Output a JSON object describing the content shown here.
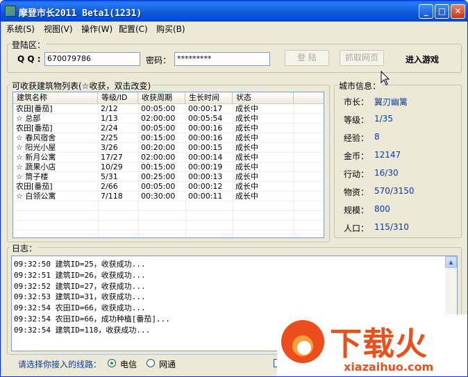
{
  "window": {
    "title": "摩登市长2011 Beta1(1231)",
    "controls": {
      "minimize": "_",
      "maximize": "□",
      "close": "✕"
    }
  },
  "menu": [
    {
      "label": "系统(S)"
    },
    {
      "label": "视图(V)"
    },
    {
      "label": "操作(W)"
    },
    {
      "label": "配置(C)"
    },
    {
      "label": "购买(B)"
    }
  ],
  "login": {
    "group_label": "登陆区：",
    "qq_label": "Q Q :",
    "qq_value": "670079786",
    "password_label": "密码：",
    "password_value": "*********",
    "login_button": "登 陆",
    "capture_button": "抓取网页",
    "enter_game": "进入游戏"
  },
  "buildings": {
    "group_label": "可收获建筑物列表(☆收获，双击改变)",
    "columns": [
      "建筑名称",
      "等级/ID",
      "收获周期",
      "生长时间",
      "状态"
    ],
    "rows": [
      {
        "name": "农田[番茄]",
        "level": "2/12",
        "cycle": "00:05:00",
        "grow": "00:00:17",
        "status": "成长中"
      },
      {
        "name": "☆ 总部",
        "level": "1/13",
        "cycle": "02:00:00",
        "grow": "00:05:54",
        "status": "成长中"
      },
      {
        "name": "农田[番茄]",
        "level": "2/24",
        "cycle": "00:05:00",
        "grow": "00:00:16",
        "status": "成长中"
      },
      {
        "name": "☆ 春风宿舍",
        "level": "2/25",
        "cycle": "00:15:00",
        "grow": "00:00:16",
        "status": "成长中"
      },
      {
        "name": "☆ 阳光小屋",
        "level": "3/26",
        "cycle": "00:20:00",
        "grow": "00:00:15",
        "status": "成长中"
      },
      {
        "name": "☆ 新月公寓",
        "level": "17/27",
        "cycle": "02:00:00",
        "grow": "00:00:14",
        "status": "成长中"
      },
      {
        "name": "☆ 蔬果小店",
        "level": "10/29",
        "cycle": "00:15:00",
        "grow": "00:00:19",
        "status": "成长中"
      },
      {
        "name": "☆ 筒子楼",
        "level": "5/31",
        "cycle": "00:25:00",
        "grow": "00:00:13",
        "status": "成长中"
      },
      {
        "name": "农田[番茄]",
        "level": "2/66",
        "cycle": "00:05:00",
        "grow": "00:00:12",
        "status": "成长中"
      },
      {
        "name": "☆ 白领公寓",
        "level": "7/118",
        "cycle": "00:30:00",
        "grow": "00:00:11",
        "status": "成长中"
      }
    ]
  },
  "city_info": {
    "group_label": "城市信息：",
    "items": [
      {
        "label": "市长：",
        "value": "翼刃幽篱"
      },
      {
        "label": "等级：",
        "value": "1/35"
      },
      {
        "label": "经验：",
        "value": "8"
      },
      {
        "label": "金币：",
        "value": "12147"
      },
      {
        "label": "行动：",
        "value": "16/30"
      },
      {
        "label": "物资：",
        "value": "570/3150"
      },
      {
        "label": "规模：",
        "value": "800"
      },
      {
        "label": "人口：",
        "value": "115/310"
      }
    ]
  },
  "log": {
    "group_label": "日志：",
    "lines": [
      "09:32:50 建筑ID=25，收获成功...",
      "09:32:51 建筑ID=26，收获成功...",
      "09:32:52 建筑ID=27，收获成功...",
      "09:32:53 建筑ID=31，收获成功...",
      "09:32:54 农田ID=66，收获成功...",
      "09:32:54 农田ID=66，成功种植[番茄]...",
      "09:32:54 建筑ID=118，收获成功..."
    ]
  },
  "route": {
    "label": "请选择你接入的线路：",
    "options": [
      {
        "label": "电信",
        "checked": true
      },
      {
        "label": "网通",
        "checked": false
      }
    ]
  },
  "watermark": {
    "brand": "下载火",
    "url": "xiazaihuo.com"
  },
  "colors": {
    "title_bar": "#0A59DA",
    "face": "#ECE9D8",
    "value_text": "#0B3A9B",
    "route_label": "#0B3A9B",
    "watermark": "#E8501C"
  }
}
